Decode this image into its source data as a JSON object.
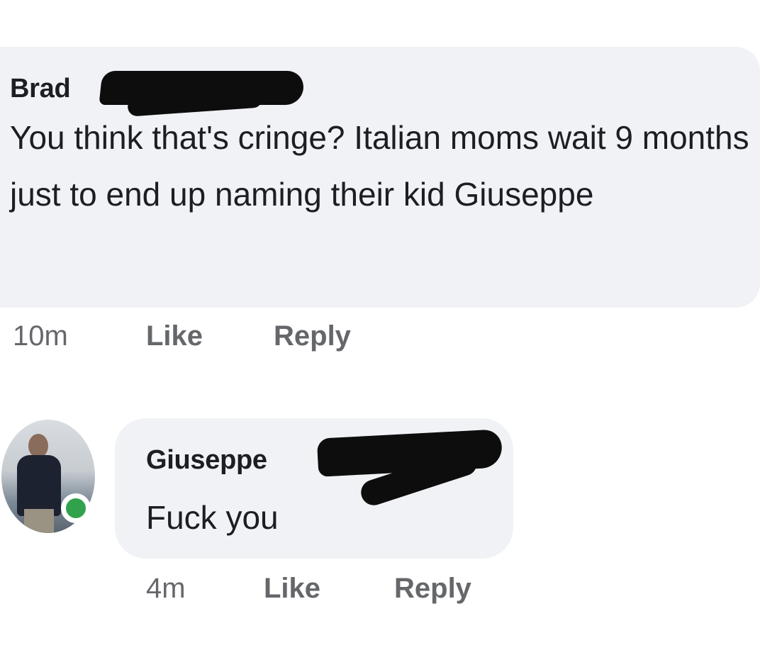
{
  "comments": [
    {
      "author": "Brad",
      "text": "You think that's cringe? Italian moms wait 9 months just to end up naming their kid Giuseppe",
      "time": "10m",
      "like_label": "Like",
      "reply_label": "Reply"
    },
    {
      "author": "Giuseppe",
      "text": "Fuck you",
      "time": "4m",
      "like_label": "Like",
      "reply_label": "Reply",
      "online_status_color": "#31a24c"
    }
  ],
  "colors": {
    "bubble": "#f0f2f5",
    "text": "#1c1e21",
    "meta": "#65676b",
    "redaction": "#0d0d0d"
  }
}
